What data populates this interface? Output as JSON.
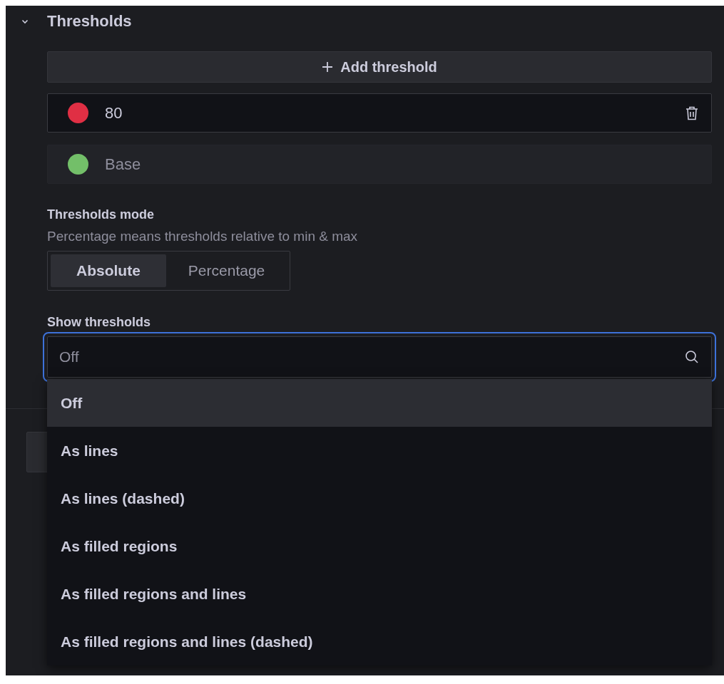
{
  "section": {
    "title": "Thresholds",
    "expanded": true
  },
  "add_button": {
    "label": "Add threshold"
  },
  "thresholds": [
    {
      "kind": "editable",
      "value": "80",
      "color": "#e02f44"
    },
    {
      "kind": "base",
      "value": "Base",
      "color": "#73bf69"
    }
  ],
  "thresholds_mode": {
    "label": "Thresholds mode",
    "description": "Percentage means thresholds relative to min & max",
    "options": [
      {
        "label": "Absolute",
        "selected": true
      },
      {
        "label": "Percentage",
        "selected": false
      }
    ]
  },
  "show_thresholds": {
    "label": "Show thresholds",
    "placeholder": "Off",
    "focused": true,
    "options": [
      {
        "label": "Off",
        "selected": true
      },
      {
        "label": "As lines",
        "selected": false
      },
      {
        "label": "As lines (dashed)",
        "selected": false
      },
      {
        "label": "As filled regions",
        "selected": false
      },
      {
        "label": "As filled regions and lines",
        "selected": false
      },
      {
        "label": "As filled regions and lines (dashed)",
        "selected": false
      }
    ]
  }
}
